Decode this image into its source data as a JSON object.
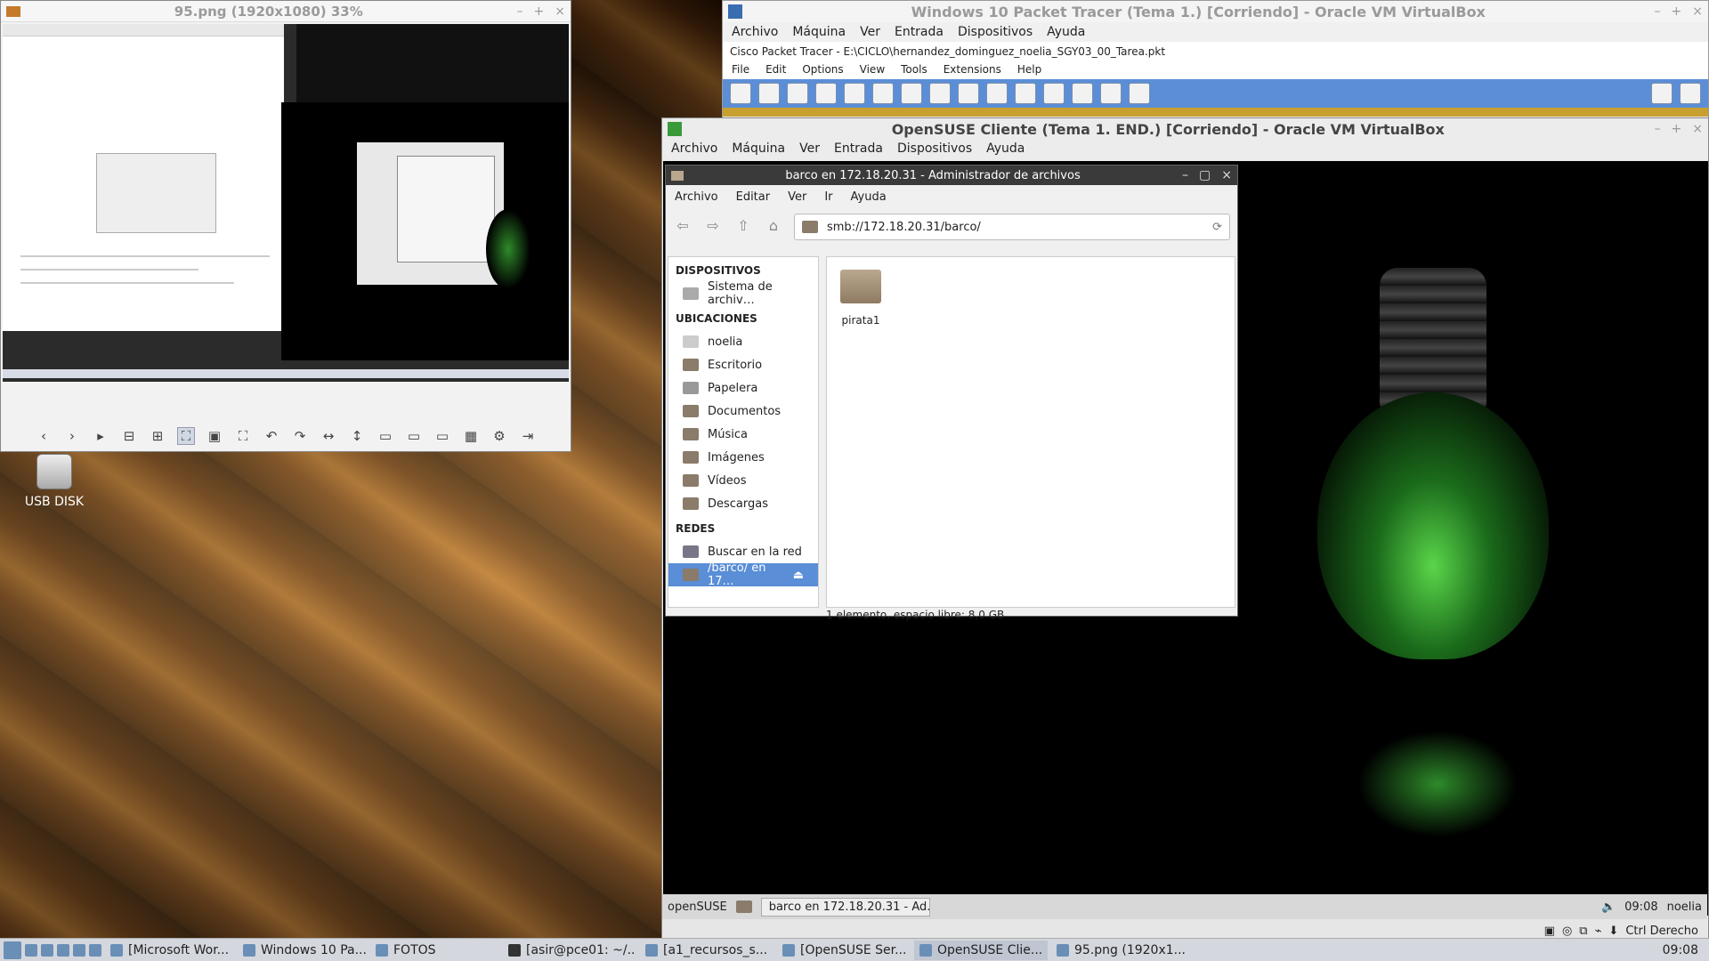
{
  "viewer": {
    "title": "95.png (1920x1080) 33%",
    "toolbar_icons": [
      "prev-icon",
      "next-icon",
      "play-icon",
      "zoom-out-icon",
      "zoom-in-icon",
      "fit-icon",
      "actual-size-icon",
      "fullscreen-icon",
      "rotate-left-icon",
      "rotate-right-icon",
      "flip-horizontal-icon",
      "flip-vertical-icon",
      "open-icon",
      "save-icon",
      "print-icon",
      "gallery-icon",
      "settings-icon",
      "exit-icon"
    ]
  },
  "desktop": {
    "usb_label": "USB DISK"
  },
  "packet_tracer_vm": {
    "title": "Windows 10 Packet Tracer (Tema 1.) [Corriendo] - Oracle VM VirtualBox",
    "menu": [
      "Archivo",
      "Máquina",
      "Ver",
      "Entrada",
      "Dispositivos",
      "Ayuda"
    ],
    "inner_title": "Cisco Packet Tracer - E:\\CICLO\\hernandez_dominguez_noelia_SGY03_00_Tarea.pkt",
    "inner_menu": [
      "File",
      "Edit",
      "Options",
      "View",
      "Tools",
      "Extensions",
      "Help"
    ]
  },
  "suse_vm": {
    "title": "OpenSUSE Cliente (Tema 1. END.) [Corriendo] - Oracle VM VirtualBox",
    "menu": [
      "Archivo",
      "Máquina",
      "Ver",
      "Entrada",
      "Dispositivos",
      "Ayuda"
    ],
    "file_manager": {
      "title": "barco en 172.18.20.31 - Administrador de archivos",
      "menu": [
        "Archivo",
        "Editar",
        "Ver",
        "Ir",
        "Ayuda"
      ],
      "location": "smb://172.18.20.31/barco/",
      "sections": {
        "devices": "DISPOSITIVOS",
        "places": "UBICACIONES",
        "networks": "REDES"
      },
      "device_items": [
        "Sistema de archiv…"
      ],
      "place_items": [
        "noelia",
        "Escritorio",
        "Papelera",
        "Documentos",
        "Música",
        "Imágenes",
        "Vídeos",
        "Descargas"
      ],
      "network_items": [
        "Buscar en la red",
        "/barco/ en 17…"
      ],
      "folder": "pirata1",
      "status": "1 elemento, espacio libre: 8,0 GB"
    },
    "panel": {
      "start": "openSUSE",
      "task": "barco en 172.18.20.31 - Ad...",
      "time": "09:08",
      "user": "noelia"
    },
    "host_key": "Ctrl Derecho"
  },
  "taskbar": {
    "items": [
      "[Microsoft Wor...",
      "Windows 10 Pa...",
      "FOTOS",
      "[asir@pce01: ~/...",
      "[a1_recursos_s...",
      "[OpenSUSE Ser...",
      "OpenSUSE Clie...",
      "95.png (1920x1..."
    ],
    "time": "09:08"
  }
}
